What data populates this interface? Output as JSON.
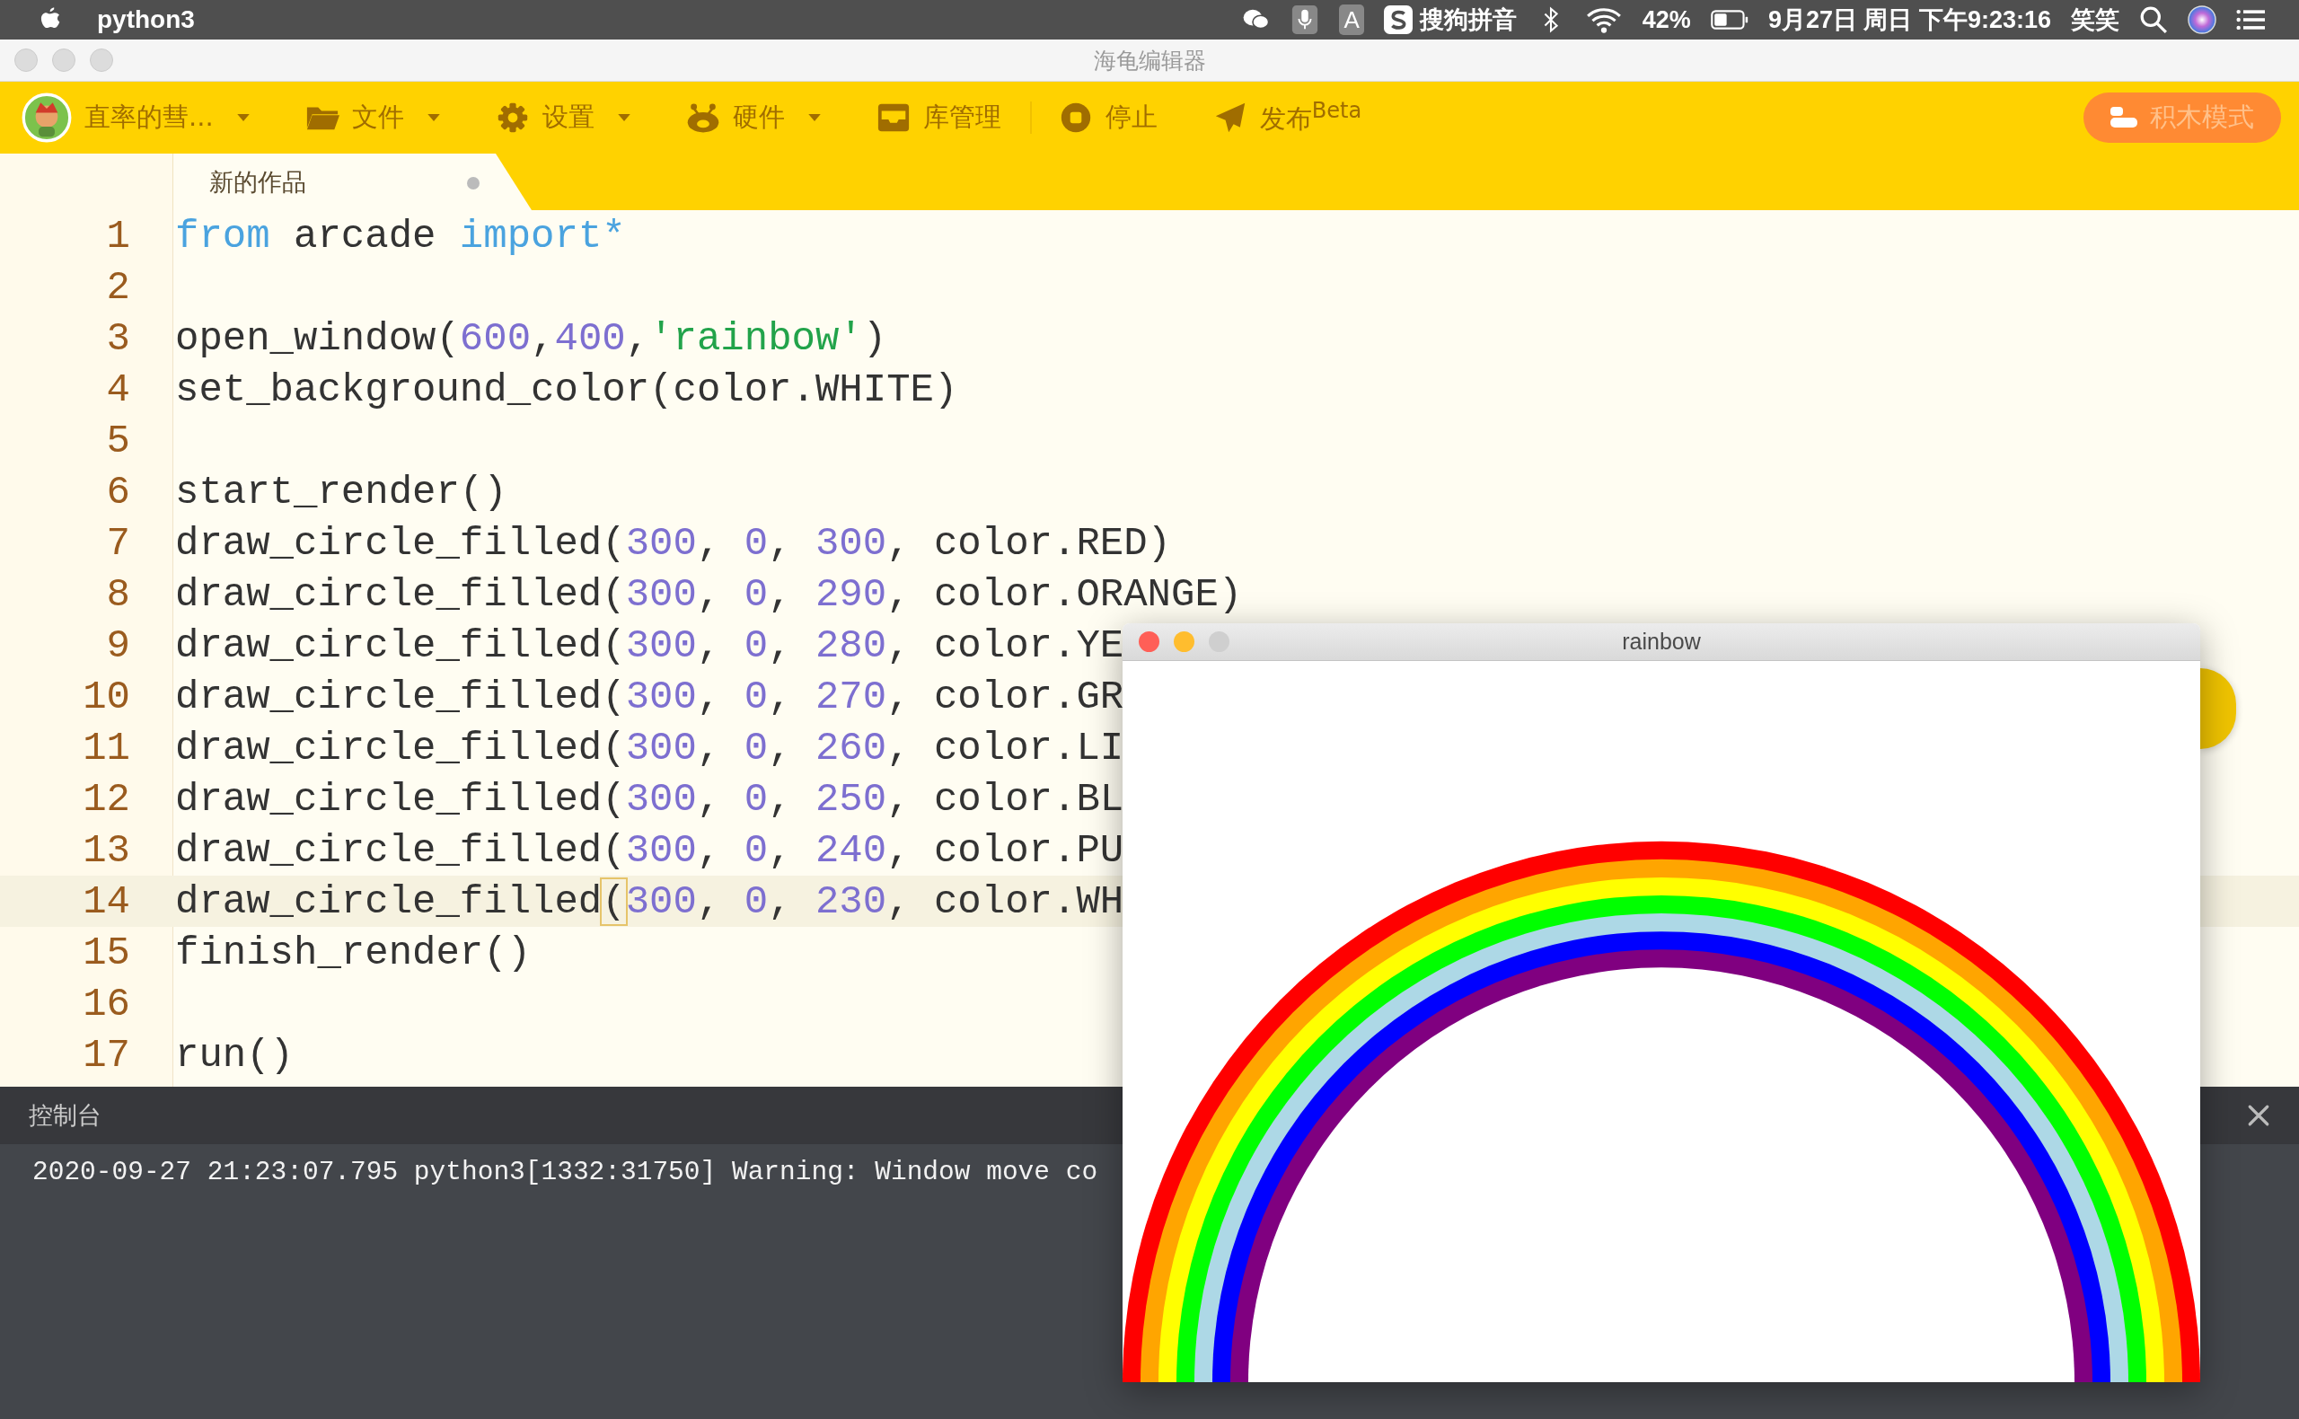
{
  "menubar": {
    "app": "python3",
    "status_items": [
      {
        "kind": "wechat"
      },
      {
        "kind": "mic"
      },
      {
        "kind": "letter",
        "text": "A"
      },
      {
        "kind": "sogou",
        "text": "搜狗拼音"
      },
      {
        "kind": "bluetooth"
      },
      {
        "kind": "wifi"
      },
      {
        "kind": "text",
        "text": "42%"
      },
      {
        "kind": "battery"
      },
      {
        "kind": "text",
        "text": "9月27日 周日 下午9:23:16"
      },
      {
        "kind": "text",
        "text": "笑笑"
      },
      {
        "kind": "search"
      },
      {
        "kind": "siri"
      },
      {
        "kind": "list"
      }
    ]
  },
  "window": {
    "title": "海龟编辑器"
  },
  "toolbar": {
    "items": [
      {
        "kind": "user",
        "label": "直率的彗...",
        "has_menu": true
      },
      {
        "kind": "folder",
        "label": "文件",
        "has_menu": true
      },
      {
        "kind": "gear",
        "label": "设置",
        "has_menu": true
      },
      {
        "kind": "hardware",
        "label": "硬件",
        "has_menu": true
      },
      {
        "kind": "library",
        "label": "库管理",
        "has_menu": false
      },
      {
        "kind": "stop",
        "label": "停止",
        "has_menu": false
      },
      {
        "kind": "send",
        "label": "发布$^{Beta}$",
        "has_menu": false
      }
    ],
    "mode_button": "积木模式"
  },
  "tabs": [
    {
      "label": "新的作品",
      "selected": true,
      "modified": true
    }
  ],
  "editor": {
    "lines": [
      {
        "number": "1",
        "current": false,
        "tokens": [
          {
            "kind": "keyword",
            "text": "from"
          },
          {
            "kind": "plain",
            "text": " arcade "
          },
          {
            "kind": "keyword",
            "text": "import*"
          }
        ]
      },
      {
        "number": "2",
        "current": false
      },
      {
        "number": "3",
        "current": false,
        "tokens": [
          {
            "kind": "plain",
            "text": "open_window("
          },
          {
            "kind": "number",
            "text": "600"
          },
          {
            "kind": "plain",
            "text": ","
          },
          {
            "kind": "number",
            "text": "400"
          },
          {
            "kind": "plain",
            "text": ","
          },
          {
            "kind": "string",
            "text": "'rainbow'"
          },
          {
            "kind": "plain",
            "text": ")"
          }
        ]
      },
      {
        "number": "4",
        "current": false,
        "tokens": [
          {
            "kind": "plain",
            "text": "set_background_color(color.WHITE)"
          }
        ]
      },
      {
        "number": "5",
        "current": false
      },
      {
        "number": "6",
        "current": false,
        "tokens": [
          {
            "kind": "plain",
            "text": "start_render()"
          }
        ]
      },
      {
        "number": "7",
        "current": false,
        "tokens": [
          {
            "kind": "plain",
            "text": "draw_circle_filled("
          },
          {
            "kind": "number",
            "text": "300"
          },
          {
            "kind": "plain",
            "text": ", "
          },
          {
            "kind": "number",
            "text": "0"
          },
          {
            "kind": "plain",
            "text": ", "
          },
          {
            "kind": "number",
            "text": "300"
          },
          {
            "kind": "plain",
            "text": ", color.RED)"
          }
        ]
      },
      {
        "number": "8",
        "current": false,
        "tokens": [
          {
            "kind": "plain",
            "text": "draw_circle_filled("
          },
          {
            "kind": "number",
            "text": "300"
          },
          {
            "kind": "plain",
            "text": ", "
          },
          {
            "kind": "number",
            "text": "0"
          },
          {
            "kind": "plain",
            "text": ", "
          },
          {
            "kind": "number",
            "text": "290"
          },
          {
            "kind": "plain",
            "text": ", color.ORANGE)"
          }
        ]
      },
      {
        "number": "9",
        "current": false,
        "tokens": [
          {
            "kind": "plain",
            "text": "draw_circle_filled("
          },
          {
            "kind": "number",
            "text": "300"
          },
          {
            "kind": "plain",
            "text": ", "
          },
          {
            "kind": "number",
            "text": "0"
          },
          {
            "kind": "plain",
            "text": ", "
          },
          {
            "kind": "number",
            "text": "280"
          },
          {
            "kind": "plain",
            "text": ", color.YE"
          }
        ]
      },
      {
        "number": "10",
        "current": false,
        "tokens": [
          {
            "kind": "plain",
            "text": "draw_circle_filled("
          },
          {
            "kind": "number",
            "text": "300"
          },
          {
            "kind": "plain",
            "text": ", "
          },
          {
            "kind": "number",
            "text": "0"
          },
          {
            "kind": "plain",
            "text": ", "
          },
          {
            "kind": "number",
            "text": "270"
          },
          {
            "kind": "plain",
            "text": ", color.GR"
          }
        ]
      },
      {
        "number": "11",
        "current": false,
        "tokens": [
          {
            "kind": "plain",
            "text": "draw_circle_filled("
          },
          {
            "kind": "number",
            "text": "300"
          },
          {
            "kind": "plain",
            "text": ", "
          },
          {
            "kind": "number",
            "text": "0"
          },
          {
            "kind": "plain",
            "text": ", "
          },
          {
            "kind": "number",
            "text": "260"
          },
          {
            "kind": "plain",
            "text": ", color.LI"
          }
        ]
      },
      {
        "number": "12",
        "current": false,
        "tokens": [
          {
            "kind": "plain",
            "text": "draw_circle_filled("
          },
          {
            "kind": "number",
            "text": "300"
          },
          {
            "kind": "plain",
            "text": ", "
          },
          {
            "kind": "number",
            "text": "0"
          },
          {
            "kind": "plain",
            "text": ", "
          },
          {
            "kind": "number",
            "text": "250"
          },
          {
            "kind": "plain",
            "text": ", color.BL"
          }
        ]
      },
      {
        "number": "13",
        "current": false,
        "tokens": [
          {
            "kind": "plain",
            "text": "draw_circle_filled("
          },
          {
            "kind": "number",
            "text": "300"
          },
          {
            "kind": "plain",
            "text": ", "
          },
          {
            "kind": "number",
            "text": "0"
          },
          {
            "kind": "plain",
            "text": ", "
          },
          {
            "kind": "number",
            "text": "240"
          },
          {
            "kind": "plain",
            "text": ", color.PU"
          }
        ]
      },
      {
        "number": "14",
        "current": true,
        "tokens": [
          {
            "kind": "plain",
            "text": "draw_circle_filled"
          },
          {
            "kind": "bracket-match",
            "text": "("
          },
          {
            "kind": "number",
            "text": "300"
          },
          {
            "kind": "plain",
            "text": ", "
          },
          {
            "kind": "number",
            "text": "0"
          },
          {
            "kind": "plain",
            "text": ", "
          },
          {
            "kind": "number",
            "text": "230"
          },
          {
            "kind": "plain",
            "text": ", color.WH"
          }
        ]
      },
      {
        "number": "15",
        "current": false,
        "tokens": [
          {
            "kind": "plain",
            "text": "finish_render()"
          }
        ]
      },
      {
        "number": "16",
        "current": false
      },
      {
        "number": "17",
        "current": false,
        "tokens": [
          {
            "kind": "plain",
            "text": "run()"
          }
        ]
      }
    ]
  },
  "console": {
    "title": "控制台",
    "lines": [
      "2020-09-27 21:23:07.795 python3[1332:31750] Warning: Window move co"
    ]
  },
  "app_window": {
    "title": "rainbow"
  }
}
